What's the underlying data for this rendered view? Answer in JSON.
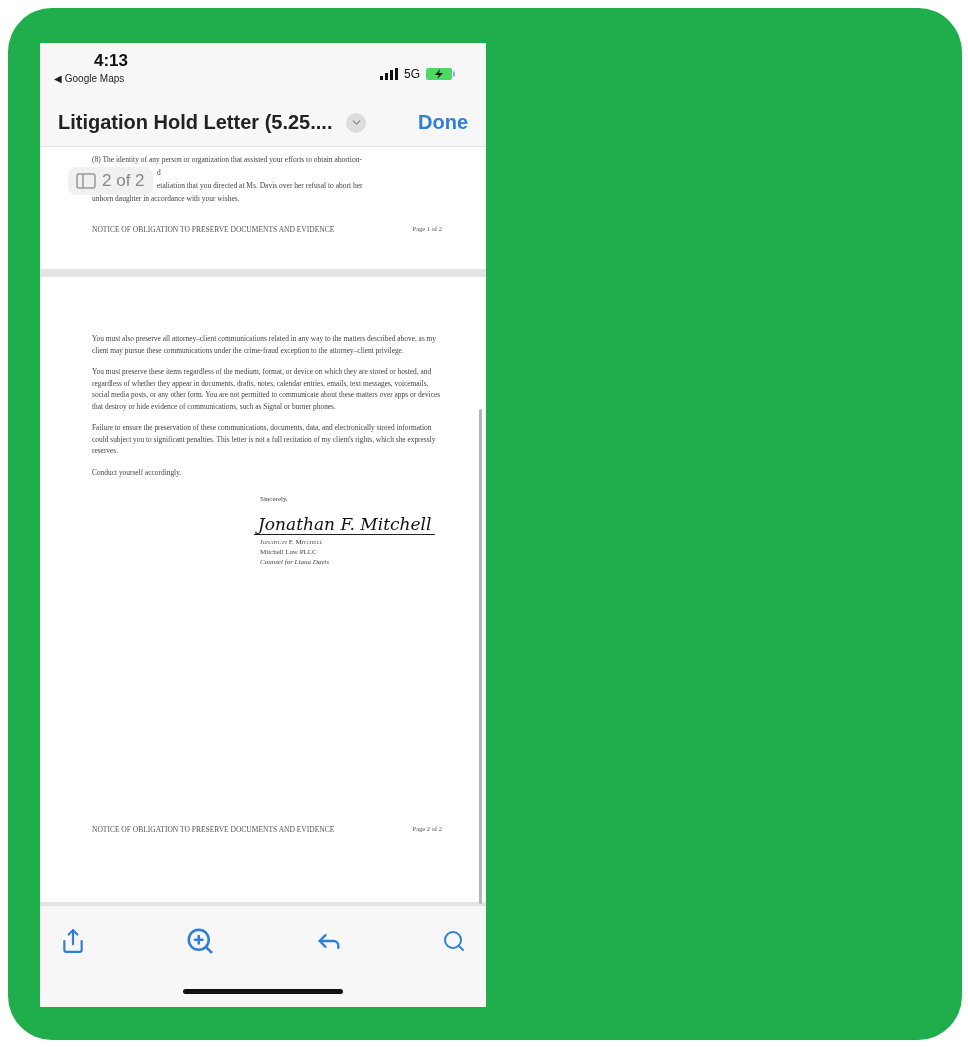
{
  "status_bar": {
    "time": "4:13",
    "back_app": "◀ Google Maps",
    "network": "5G"
  },
  "nav_bar": {
    "title": "Litigation Hold Letter (5.25....",
    "done": "Done"
  },
  "page_badge": {
    "label": "2 of 2"
  },
  "page_1": {
    "lines": [
      {
        "text": "(8) The identity of any person or organization that assisted your efforts to obtain abortion-",
        "indent": false
      },
      {
        "text": "d",
        "indent": true
      },
      {
        "text": "etaliation that you directed at Ms. Davis over her refusal to abort her",
        "indent": true
      },
      {
        "text": "unborn daughter in accordance with your wishes.",
        "indent": false
      }
    ],
    "footer_title": "NOTICE OF OBLIGATION TO PRESERVE DOCUMENTS AND EVIDENCE",
    "footer_page": "Page 1 of 2"
  },
  "page_2": {
    "paragraphs": [
      "You must also preserve all attorney–client communications related in any way to the matters described above, as my client may pursue these communications under the crime-fraud exception to the attorney–client privilege.",
      "You must preserve these items regardless of the medium, format, or device on which they are stored or hosted, and regardless of whether they appear in documents, drafts, notes, calendar entries, emails, text messages, voicemails, social media posts, or any other form. You are not permitted to communicate about these matters over apps or devices that destroy or hide evidence of communications, such as Signal or burner phones.",
      "Failure to ensure the preservation of these communications, documents, data, and electronically stored information could subject you to significant penalties. This letter is not a full recitation of my client's rights, which she expressly reserves.",
      "Conduct yourself accordingly."
    ],
    "closing": "Sincerely,",
    "signature": "Jonathan F. Mitchell",
    "signer_name": "Jonathan F. Mitchell",
    "firm": "Mitchell Law PLLC",
    "role": "Counsel for Liana Davis",
    "footer_title": "NOTICE OF OBLIGATION TO PRESERVE DOCUMENTS AND EVIDENCE",
    "footer_page": "Page 2 of 2"
  }
}
